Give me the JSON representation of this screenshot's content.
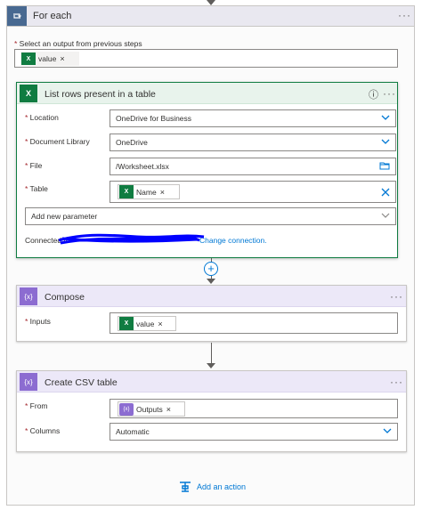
{
  "foreach": {
    "title": "For each",
    "select_label": "Select an output from previous steps",
    "token_value": "value",
    "menu": "···"
  },
  "list_rows": {
    "title": "List rows present in a table",
    "info": "ⓘ",
    "menu": "···",
    "location_label": "Location",
    "location_value": "OneDrive for Business",
    "library_label": "Document Library",
    "library_value": "OneDrive",
    "file_label": "File",
    "file_value": "/Worksheet.xlsx",
    "table_label": "Table",
    "table_token": "Name",
    "add_param": "Add new parameter",
    "connected_prefix": "Connected to",
    "change_connection": "Change connection."
  },
  "compose": {
    "title": "Compose",
    "menu": "···",
    "inputs_label": "Inputs",
    "inputs_token": "value"
  },
  "csv": {
    "title": "Create CSV table",
    "menu": "···",
    "from_label": "From",
    "from_token": "Outputs",
    "columns_label": "Columns",
    "columns_value": "Automatic"
  },
  "add_action": "Add an action",
  "icons": {
    "foreach": "loop-icon",
    "excel": "excel-icon",
    "expression": "expression-icon"
  },
  "colors": {
    "excel_green": "#107c41",
    "expression_purple": "#8c6cd1",
    "accent_blue": "#0078d4",
    "foreach_blue": "#486991"
  }
}
